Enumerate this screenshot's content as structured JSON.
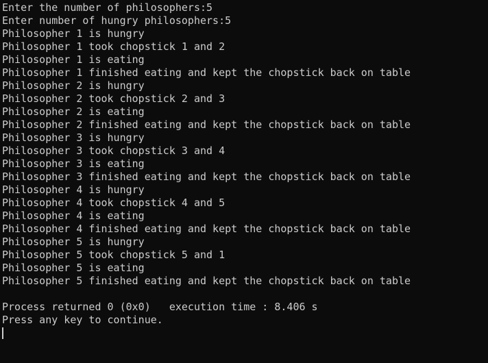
{
  "terminal": {
    "lines": [
      "Enter the number of philosophers:5",
      "Enter number of hungry philosophers:5",
      "Philosopher 1 is hungry",
      "Philosopher 1 took chopstick 1 and 2",
      "Philosopher 1 is eating",
      "Philosopher 1 finished eating and kept the chopstick back on table",
      "Philosopher 2 is hungry",
      "Philosopher 2 took chopstick 2 and 3",
      "Philosopher 2 is eating",
      "Philosopher 2 finished eating and kept the chopstick back on table",
      "Philosopher 3 is hungry",
      "Philosopher 3 took chopstick 3 and 4",
      "Philosopher 3 is eating",
      "Philosopher 3 finished eating and kept the chopstick back on table",
      "Philosopher 4 is hungry",
      "Philosopher 4 took chopstick 4 and 5",
      "Philosopher 4 is eating",
      "Philosopher 4 finished eating and kept the chopstick back on table",
      "Philosopher 5 is hungry",
      "Philosopher 5 took chopstick 5 and 1",
      "Philosopher 5 is eating",
      "Philosopher 5 finished eating and kept the chopstick back on table",
      "",
      "Process returned 0 (0x0)   execution time : 8.406 s",
      "Press any key to continue."
    ],
    "colors": {
      "background": "#0c0c0c",
      "text": "#cccccc"
    }
  }
}
